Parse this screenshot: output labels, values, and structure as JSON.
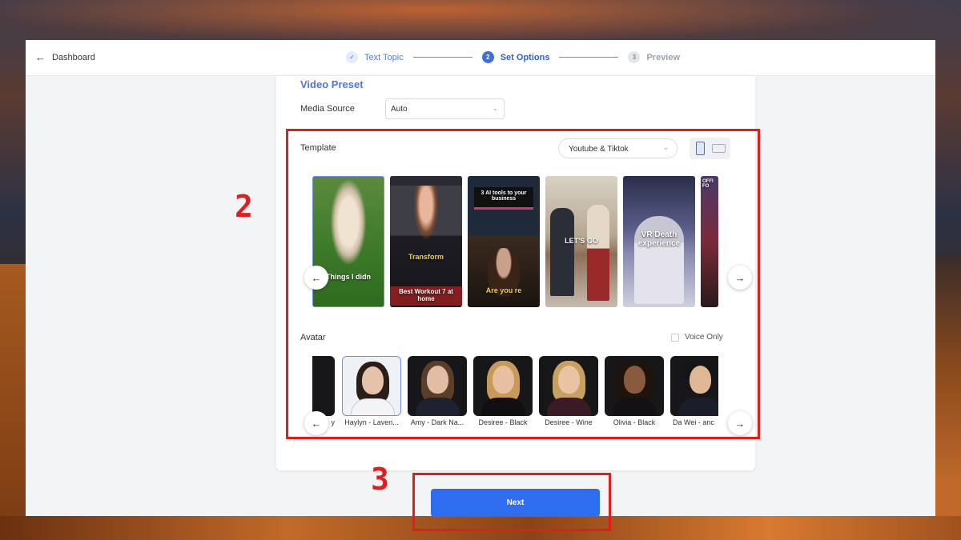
{
  "header": {
    "back_label": "Dashboard"
  },
  "stepper": {
    "steps": [
      {
        "number": "1",
        "label": "Text Topic",
        "state": "done"
      },
      {
        "number": "2",
        "label": "Set Options",
        "state": "active"
      },
      {
        "number": "3",
        "label": "Preview",
        "state": "todo"
      }
    ]
  },
  "video_preset": {
    "title": "Video Preset",
    "media_source_label": "Media Source",
    "media_source_value": "Auto"
  },
  "template": {
    "label": "Template",
    "platform_value": "Youtube & Tiktok",
    "thumbnails": [
      {
        "caption": "Things I didn"
      },
      {
        "caption_top": "Transform",
        "caption_bottom": "Best Workout 7 at home"
      },
      {
        "caption_top": "3 AI tools to your business",
        "caption_bottom": "Are you re"
      },
      {
        "caption": "LET'S GO"
      },
      {
        "caption": "VR Death experience"
      },
      {
        "caption": "OFFI FO"
      }
    ]
  },
  "avatar": {
    "label": "Avatar",
    "voice_only_label": "Voice Only",
    "items": [
      {
        "name": "y"
      },
      {
        "name": "Haylyn - Laven..."
      },
      {
        "name": "Amy - Dark Na..."
      },
      {
        "name": "Desiree - Black"
      },
      {
        "name": "Desiree - Wine"
      },
      {
        "name": "Olivia - Black"
      },
      {
        "name": "Da Wei - anc"
      }
    ]
  },
  "actions": {
    "next_label": "Next"
  },
  "annotations": {
    "box_2": "2",
    "box_3": "3"
  },
  "colors": {
    "accent": "#2f6df0",
    "annotation": "#e01e1e"
  }
}
